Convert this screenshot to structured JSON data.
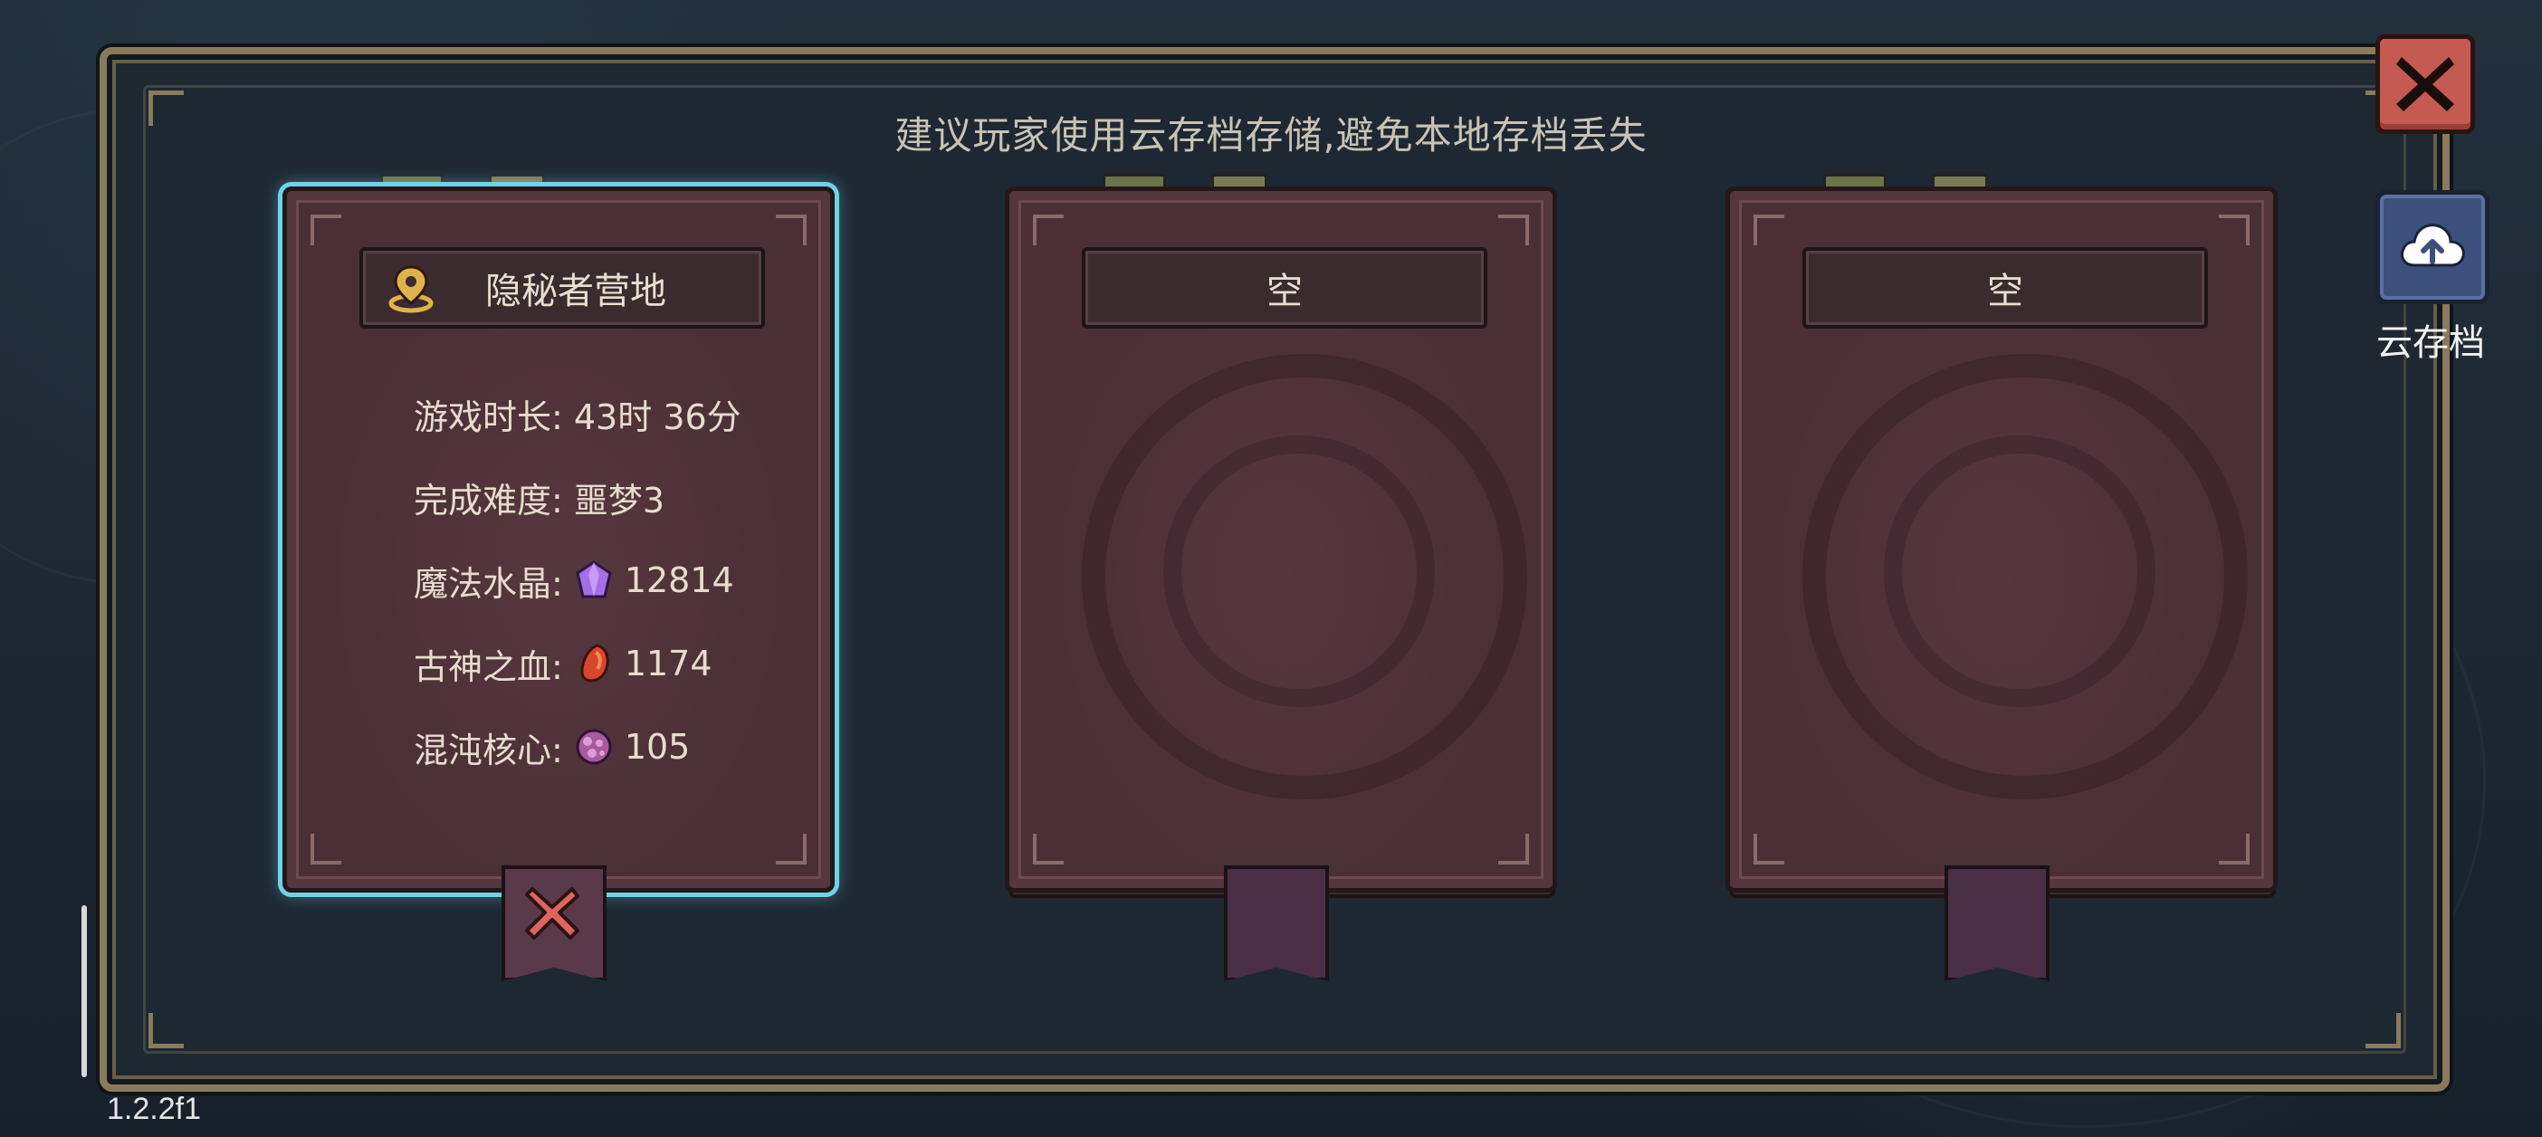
{
  "hint": "建议玩家使用云存档存储,避免本地存档丢失",
  "slots": [
    {
      "title": "隐秘者营地",
      "icon": "map-pin-icon",
      "selected": true,
      "stats": {
        "playtime": "游戏时长: 43时 36分",
        "difficulty": "完成难度: 噩梦3",
        "magic_crystal_label": "魔法水晶:",
        "magic_crystal_value": "12814",
        "ancient_blood_label": "古神之血:",
        "ancient_blood_value": "1174",
        "chaos_core_label": "混沌核心:",
        "chaos_core_value": "105"
      },
      "ribbon": "delete-x-icon"
    },
    {
      "title": "空",
      "selected": false
    },
    {
      "title": "空",
      "selected": false
    }
  ],
  "cloud_save": {
    "label": "云存档",
    "icon": "cloud-upload-icon"
  },
  "close_icon": "close-icon",
  "version": "1.2.2f1",
  "colors": {
    "selected_glow": "#6fd2e6",
    "close_red": "#c45a52",
    "cloud_blue": "#3d4f7d",
    "book": "#4a2f36"
  }
}
